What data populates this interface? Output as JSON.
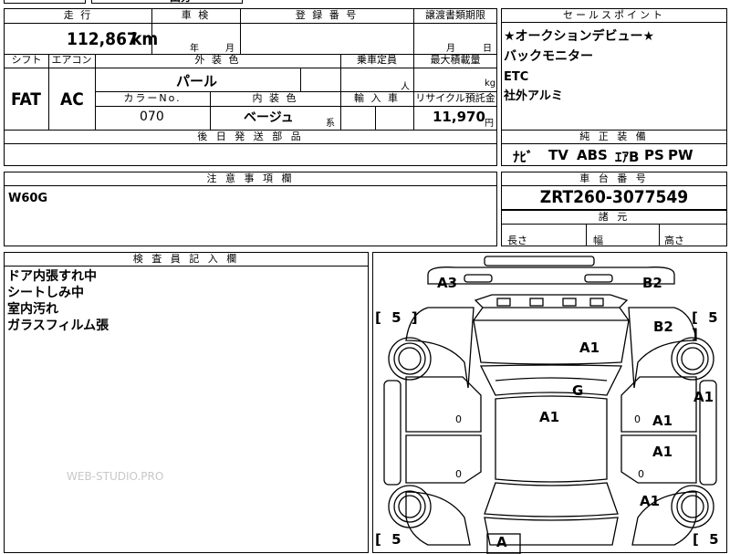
{
  "top_stub": {
    "text": "田分"
  },
  "row1": {
    "mileage_hdr": "走 行",
    "mileage_value": "112,867",
    "mileage_unit": "km",
    "shaken_hdr": "車 検",
    "shaken_year_unit": "年",
    "shaken_month_unit": "月",
    "reg_hdr": "登 録 番 号",
    "reg_value": "",
    "deadline_hdr": "譲渡書類期限",
    "deadline_month_unit": "月",
    "deadline_day_unit": "日"
  },
  "row2": {
    "shift_hdr": "シフト",
    "shift_value": "FAT",
    "ac_hdr": "エアコン",
    "ac_value": "AC",
    "exterior_hdr": "外 装 色",
    "exterior_value": "パール",
    "capacity_hdr": "乗車定員",
    "capacity_unit": "人",
    "maxload_hdr": "最大積載量",
    "maxload_unit": "kg",
    "colorno_hdr": "カラーNo.",
    "colorno_value": "070",
    "interior_hdr": "内 装 色",
    "interior_value": "ベージュ",
    "interior_unit": "系",
    "import_hdr": "輸 入 車",
    "recycle_hdr": "リサイクル預託金",
    "recycle_value": "11,970",
    "recycle_unit": "円"
  },
  "later_parts": {
    "header": "後 日 発 送 部 品",
    "value": ""
  },
  "sales_points": {
    "header": "セールスポイント",
    "items": [
      "★オークションデビュー★",
      "バックモニター",
      "ETC",
      "社外アルミ"
    ]
  },
  "equipment": {
    "header": "純 正 装 備",
    "items": [
      "ﾅﾋﾞ",
      "TV",
      "ABS",
      "ｴｱB",
      "PS",
      "PW"
    ]
  },
  "caution": {
    "header": "注 意 事 項 欄",
    "value": "W60G"
  },
  "chassis": {
    "header": "車 台 番 号",
    "value": "ZRT260-3077549"
  },
  "dimensions": {
    "header": "諸 元",
    "length_label": "長さ",
    "width_label": "幅",
    "height_label": "高さ"
  },
  "inspector": {
    "header": "検 査 員 記 入 欄",
    "notes": [
      "ドア内張すれ中",
      "シートしみ中",
      "室内汚れ",
      "ガラスフィルム張"
    ]
  },
  "diagram": {
    "marks": {
      "a3": "A3",
      "b2_top": "B2",
      "b2_mid": "B2",
      "a1_hood": "A1",
      "a1_right_edge": "A1",
      "g": "G",
      "a1_center": "A1",
      "a1_door1": "A1",
      "a1_door2": "A1",
      "a1_rear": "A1",
      "a_bottom": "A"
    },
    "brackets": {
      "tl": "[ 5 ]",
      "tr": "[ 5 ]",
      "bl": "[ 5",
      "br": "[ 5"
    },
    "small_zero": "0"
  },
  "watermark": "WEB-STUDIO.PRO"
}
